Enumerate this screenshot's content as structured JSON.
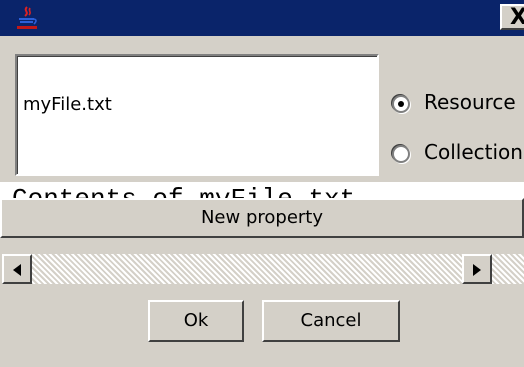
{
  "window": {
    "app_icon": "java-cup-icon",
    "close_label": "X",
    "colors": {
      "titlebar": "#0a246a",
      "face": "#d4d0c8"
    }
  },
  "name_field": {
    "value": "myFile.txt"
  },
  "type_options": [
    {
      "label": "Resource",
      "selected": true
    },
    {
      "label": "Collection",
      "selected": false
    }
  ],
  "contents_text": "Contents of myFile.txt.",
  "new_property_label": "New property",
  "scrollbar": {
    "left_icon": "arrow-left-icon",
    "right_icon": "arrow-right-icon"
  },
  "buttons": {
    "ok": "Ok",
    "cancel": "Cancel"
  }
}
